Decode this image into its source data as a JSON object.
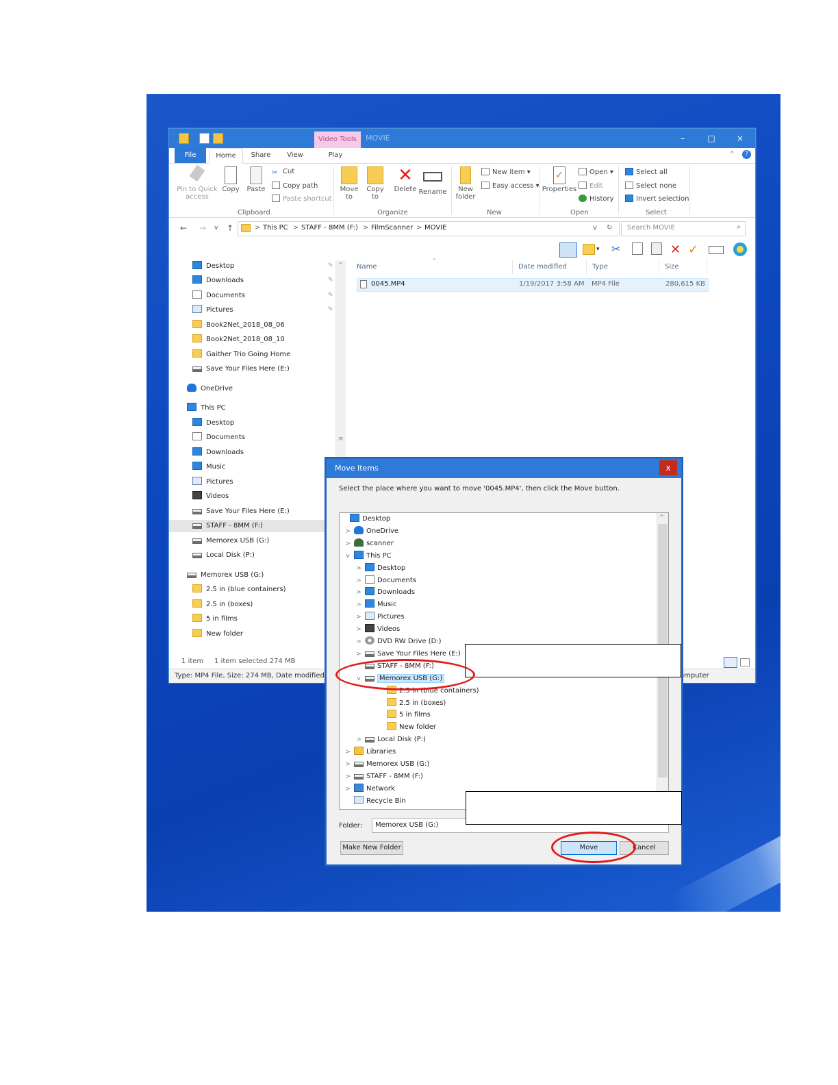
{
  "explorer": {
    "context_tab": "Video Tools",
    "window_title": "MOVIE",
    "tabs": [
      "File",
      "Home",
      "Share",
      "View",
      "Play"
    ],
    "ribbon": {
      "pin_label": "Pin to Quick access",
      "copy_label": "Copy",
      "paste_label": "Paste",
      "cut_label": "Cut",
      "copy_path_label": "Copy path",
      "paste_shortcut_label": "Paste shortcut",
      "clipboard_group": "Clipboard",
      "move_to_label": "Move to",
      "copy_to_label": "Copy to",
      "delete_label": "Delete",
      "rename_label": "Rename",
      "organize_group": "Organize",
      "new_folder_label": "New folder",
      "new_item_label": "New item",
      "easy_access_label": "Easy access",
      "new_group": "New",
      "properties_label": "Properties",
      "open_label": "Open",
      "edit_label": "Edit",
      "history_label": "History",
      "open_group": "Open",
      "select_all_label": "Select all",
      "select_none_label": "Select none",
      "invert_selection_label": "Invert selection",
      "select_group": "Select"
    },
    "breadcrumb": [
      "This PC",
      "STAFF - 8MM (F:)",
      "FilmScanner",
      "MOVIE"
    ],
    "search_placeholder": "Search MOVIE",
    "nav_items": [
      {
        "label": "Desktop",
        "icon": "desktop-icon",
        "pinned": true
      },
      {
        "label": "Downloads",
        "icon": "downloads-icon",
        "pinned": true
      },
      {
        "label": "Documents",
        "icon": "documents-icon",
        "pinned": true
      },
      {
        "label": "Pictures",
        "icon": "pictures-icon",
        "pinned": true
      },
      {
        "label": "Book2Net_2018_08_06",
        "icon": "folder-icon"
      },
      {
        "label": "Book2Net_2018_08_10",
        "icon": "folder-icon"
      },
      {
        "label": "Gaither Trio Going Home",
        "icon": "folder-icon"
      },
      {
        "label": "Save Your Files Here (E:)",
        "icon": "drive-icon"
      },
      {
        "label": "OneDrive",
        "icon": "onedrive-icon"
      },
      {
        "label": "This PC",
        "icon": "pc-icon"
      },
      {
        "label": "Desktop",
        "icon": "desktop-icon"
      },
      {
        "label": "Documents",
        "icon": "documents-icon"
      },
      {
        "label": "Downloads",
        "icon": "downloads-icon"
      },
      {
        "label": "Music",
        "icon": "music-icon"
      },
      {
        "label": "Pictures",
        "icon": "pictures-icon"
      },
      {
        "label": "Videos",
        "icon": "videos-icon"
      },
      {
        "label": "Save Your Files Here (E:)",
        "icon": "drive-icon"
      },
      {
        "label": "STAFF - 8MM (F:)",
        "icon": "drive-icon",
        "selected": true
      },
      {
        "label": "Memorex USB (G:)",
        "icon": "drive-icon"
      },
      {
        "label": "Local Disk (P:)",
        "icon": "drive-icon"
      },
      {
        "label": "Memorex USB (G:)",
        "icon": "drive-icon"
      },
      {
        "label": "2.5 in (blue containers)",
        "icon": "folder-icon"
      },
      {
        "label": "2.5 in (boxes)",
        "icon": "folder-icon"
      },
      {
        "label": "5 in films",
        "icon": "folder-icon"
      },
      {
        "label": "New folder",
        "icon": "folder-icon"
      }
    ],
    "columns": [
      "Name",
      "Date modified",
      "Type",
      "Size"
    ],
    "file": {
      "name": "0045.MP4",
      "date": "1/19/2017 3:58 AM",
      "type": "MP4 File",
      "size": "280,615 KB"
    },
    "status_items": "1 item",
    "status_selected": "1 item selected  274 MB",
    "detail_text": "Type: MP4 File, Size: 274 MB, Date modified: 1/",
    "detail_right": "omputer"
  },
  "dialog": {
    "title": "Move Items",
    "close_glyph": "x",
    "prompt": "Select the place where you want to move '0045.MP4', then click the Move button.",
    "tree": [
      {
        "label": "Desktop",
        "icon": "desktop-icon",
        "chev": ""
      },
      {
        "label": "OneDrive",
        "icon": "onedrive-icon",
        "chev": ">"
      },
      {
        "label": "scanner",
        "icon": "user-icon",
        "chev": ">"
      },
      {
        "label": "This PC",
        "icon": "pc-icon",
        "chev": "v"
      },
      {
        "label": "Desktop",
        "icon": "desktop-icon",
        "chev": ">"
      },
      {
        "label": "Documents",
        "icon": "documents-icon",
        "chev": ">"
      },
      {
        "label": "Downloads",
        "icon": "downloads-icon",
        "chev": ">"
      },
      {
        "label": "Music",
        "icon": "music-icon",
        "chev": ">"
      },
      {
        "label": "Pictures",
        "icon": "pictures-icon",
        "chev": ">"
      },
      {
        "label": "Videos",
        "icon": "videos-icon",
        "chev": ">"
      },
      {
        "label": "DVD RW Drive (D:)",
        "icon": "dvd-icon",
        "chev": ">"
      },
      {
        "label": "Save Your Files Here (E:)",
        "icon": "drive-icon",
        "chev": ">"
      },
      {
        "label": "STAFF - 8MM (F:)",
        "icon": "drive-icon",
        "chev": ""
      },
      {
        "label": "Memorex USB (G:)",
        "icon": "drive-icon",
        "chev": "v",
        "selected": true
      },
      {
        "label": "2.5 in (blue containers)",
        "icon": "folder-icon",
        "chev": ""
      },
      {
        "label": "2.5 in (boxes)",
        "icon": "folder-icon",
        "chev": ""
      },
      {
        "label": "5 in films",
        "icon": "folder-icon",
        "chev": ""
      },
      {
        "label": "New folder",
        "icon": "folder-icon",
        "chev": ""
      },
      {
        "label": "Local Disk (P:)",
        "icon": "drive-icon",
        "chev": ">"
      },
      {
        "label": "Libraries",
        "icon": "libraries-icon",
        "chev": ">"
      },
      {
        "label": "Memorex USB (G:)",
        "icon": "drive-icon",
        "chev": ">"
      },
      {
        "label": "STAFF - 8MM (F:)",
        "icon": "drive-icon",
        "chev": ">"
      },
      {
        "label": "Network",
        "icon": "network-icon",
        "chev": ">"
      },
      {
        "label": "Recycle Bin",
        "icon": "recycle-bin-icon",
        "chev": ""
      }
    ],
    "folder_label": "Folder:",
    "folder_value": "Memorex USB (G:)",
    "make_new_folder_label": "Make New Folder",
    "move_label": "Move",
    "cancel_label": "Cancel"
  },
  "colors": {
    "accent": "#2d7ad8",
    "highlight_ring": "#e01a1a",
    "desktop": "#0d47c0"
  }
}
